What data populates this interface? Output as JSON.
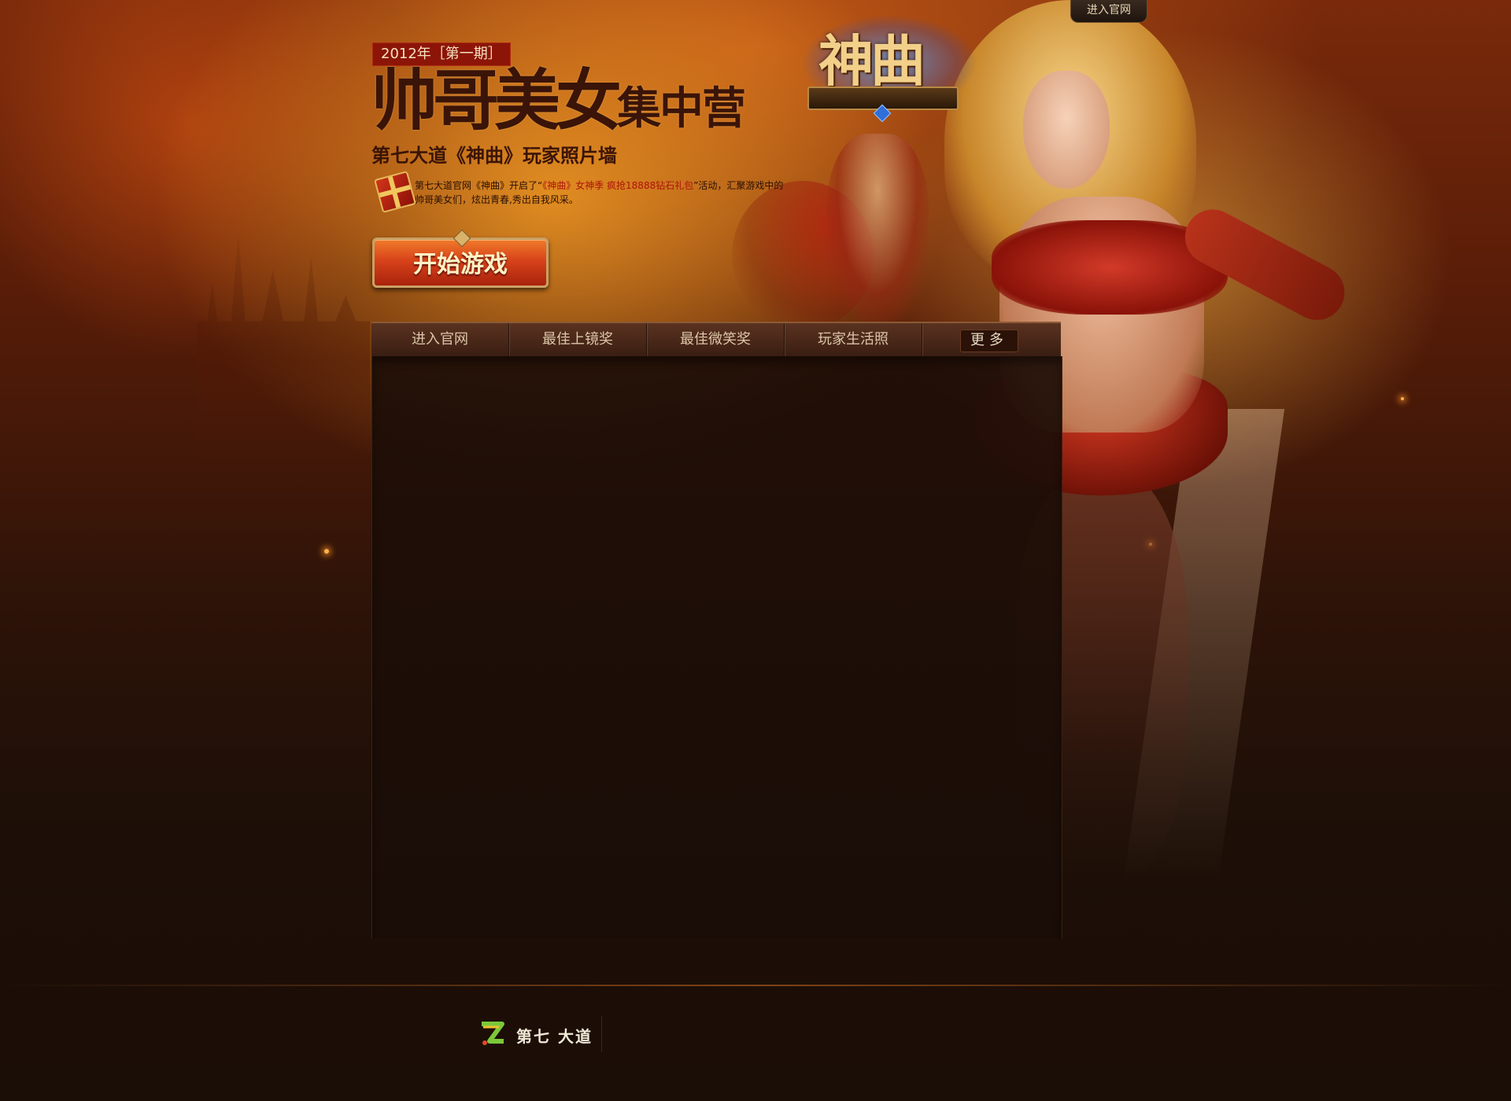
{
  "header": {
    "date_tag": "2012年［第一期］",
    "title_big": "帅哥美女",
    "title_small": "集中营",
    "subtitle": "第七大道《神曲》玩家照片墙",
    "desc_prefix": "第七大道官网《神曲》开启了“",
    "desc_highlight": "《神曲》女神季 疯抢18888钻石礼包",
    "desc_suffix": "”活动，汇聚游戏中的帅哥美女们，炫出青春,秀出自我风采。",
    "start_button": "开始游戏",
    "top_link": "进入官网"
  },
  "logo": {
    "text": "神曲"
  },
  "nav": {
    "items": [
      {
        "label": "进入官网"
      },
      {
        "label": "最佳上镜奖"
      },
      {
        "label": "最佳微笑奖"
      },
      {
        "label": "玩家生活照"
      }
    ],
    "more": "更多"
  },
  "footer": {
    "brand": "第七 大道"
  },
  "colors": {
    "accent": "#d8431a",
    "nav_bg": "#3a1e12",
    "panel_bg": "#1e0e07"
  }
}
